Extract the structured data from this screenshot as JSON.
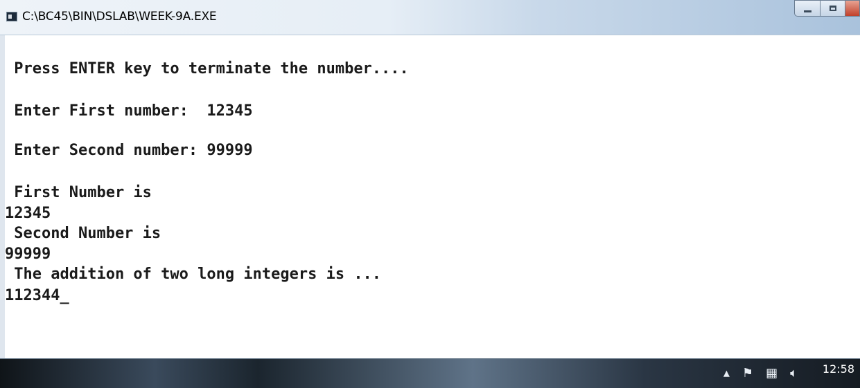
{
  "window": {
    "title": "C:\\BC45\\BIN\\DSLAB\\WEEK-9A.EXE"
  },
  "console": {
    "lines": [
      " Press ENTER key to terminate the number....",
      " Enter First number:  12345",
      " Enter Second number: 99999",
      " First Number is",
      "12345",
      " Second Number is",
      "99999",
      " The addition of two long integers is ...",
      "112344"
    ]
  },
  "taskbar": {
    "clock": "12:58",
    "tray_icons": [
      "chevron-up-icon",
      "flag-icon",
      "network-icon",
      "speaker-icon"
    ]
  }
}
